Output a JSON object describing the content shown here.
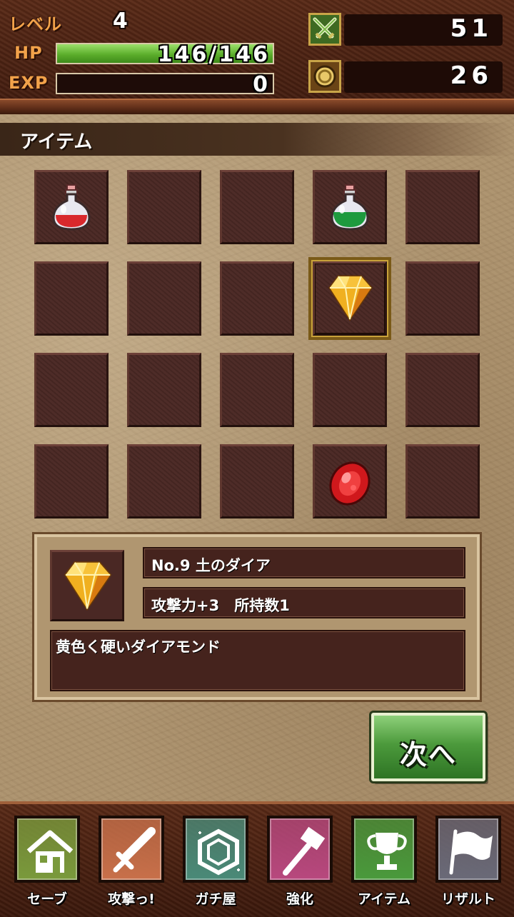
{
  "status": {
    "level_label": "レベル",
    "level_value": "4",
    "hp_label": "HP",
    "hp_text": "146/146",
    "hp_fraction": 1.0,
    "exp_label": "EXP",
    "exp_text": "0",
    "exp_fraction": 0.0,
    "attack_value": "51",
    "attack_icon": "crossed-swords-icon",
    "coin_value": "26",
    "coin_icon": "coin-icon"
  },
  "section": {
    "title": "アイテム"
  },
  "grid": {
    "columns": 5,
    "rows": 4,
    "items": [
      {
        "slot": 0,
        "icon": "red-potion-icon"
      },
      {
        "slot": 3,
        "icon": "green-potion-icon"
      },
      {
        "slot": 8,
        "icon": "yellow-diamond-icon",
        "selected": true
      },
      {
        "slot": 18,
        "icon": "red-gem-icon"
      }
    ]
  },
  "detail": {
    "icon": "yellow-diamond-icon",
    "name": "No.9 土のダイア",
    "stats": "攻撃力+3　所持数1",
    "description": "黄色く硬いダイアモンド"
  },
  "next_button": {
    "label": "次へ"
  },
  "nav": [
    {
      "label": "セーブ",
      "icon": "house-icon",
      "color": "#7a9a3c"
    },
    {
      "label": "攻撃っ!",
      "icon": "sword-icon",
      "color": "#c8704a"
    },
    {
      "label": "ガチ屋",
      "icon": "gem-shop-icon",
      "color": "#4a8a78"
    },
    {
      "label": "強化",
      "icon": "hammer-icon",
      "color": "#b8487e"
    },
    {
      "label": "アイテム",
      "icon": "trophy-icon",
      "color": "#4a9a3c"
    },
    {
      "label": "リザルト",
      "icon": "flag-icon",
      "color": "#6a6a78"
    }
  ]
}
